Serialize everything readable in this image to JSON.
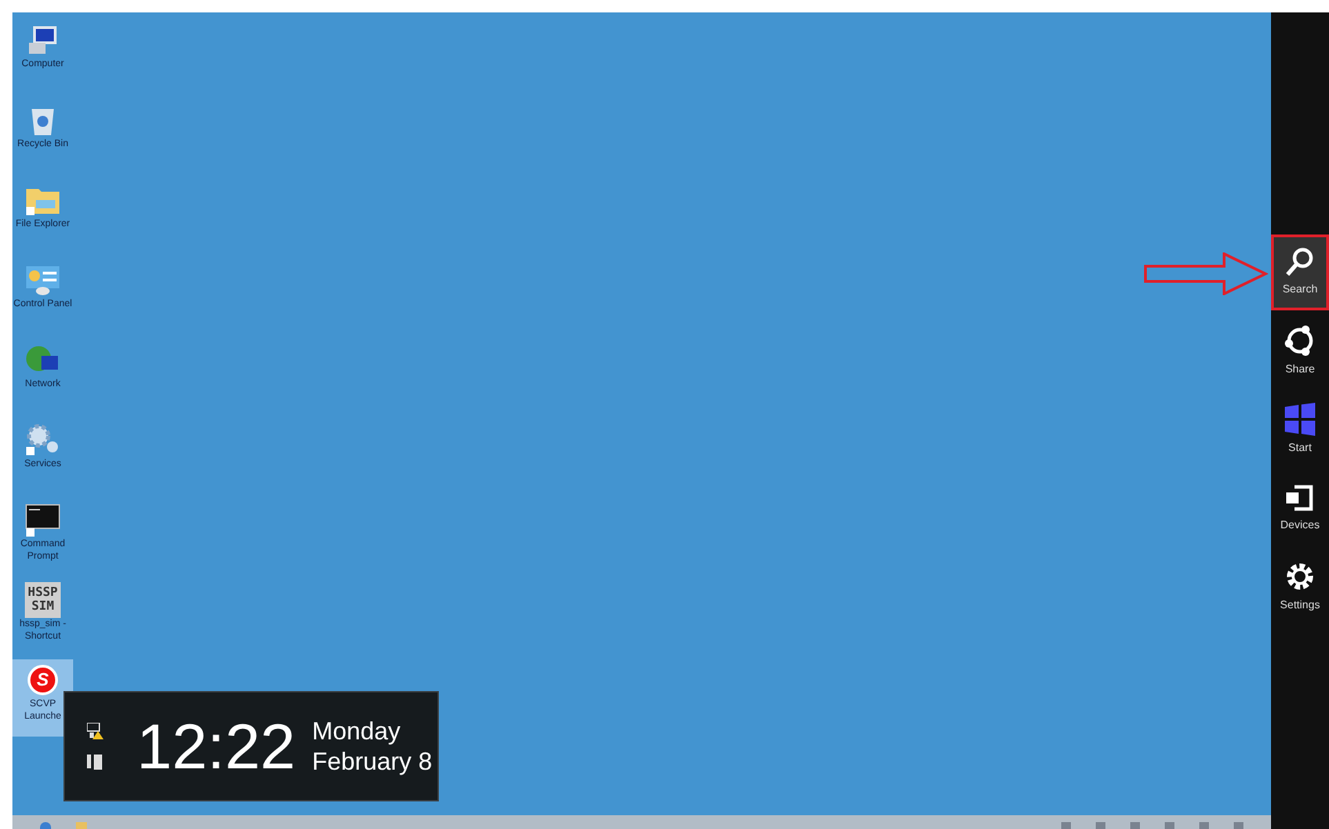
{
  "desktop_icons": [
    {
      "kind": "computer",
      "lines": [
        "Computer"
      ],
      "selected": false
    },
    {
      "kind": "recycle_bin",
      "lines": [
        "Recycle Bin"
      ],
      "selected": false
    },
    {
      "kind": "folder",
      "lines": [
        "File Explorer"
      ],
      "selected": false
    },
    {
      "kind": "control_panel",
      "lines": [
        "Control Panel"
      ],
      "selected": false
    },
    {
      "kind": "network",
      "lines": [
        "Network"
      ],
      "selected": false
    },
    {
      "kind": "services",
      "lines": [
        "Services"
      ],
      "selected": false
    },
    {
      "kind": "console",
      "lines": [
        "Command",
        "Prompt"
      ],
      "selected": false
    },
    {
      "kind": "hssp",
      "icon_text": [
        "HSSP",
        "SIM"
      ],
      "lines": [
        "hssp_sim -",
        "Shortcut"
      ],
      "selected": false
    },
    {
      "kind": "scvpp",
      "icon_text": [
        "S"
      ],
      "lines": [
        "SCVP",
        "Launche"
      ],
      "selected": true
    }
  ],
  "clock_overlay": {
    "time": "12:22",
    "day": "Monday",
    "date": "February 8"
  },
  "charms": [
    {
      "kind": "search",
      "label": "Search",
      "selected": true
    },
    {
      "kind": "share",
      "label": "Share",
      "selected": false
    },
    {
      "kind": "start",
      "label": "Start",
      "selected": false
    },
    {
      "kind": "devices",
      "label": "Devices",
      "selected": false
    },
    {
      "kind": "settings",
      "label": "Settings",
      "selected": false
    }
  ]
}
